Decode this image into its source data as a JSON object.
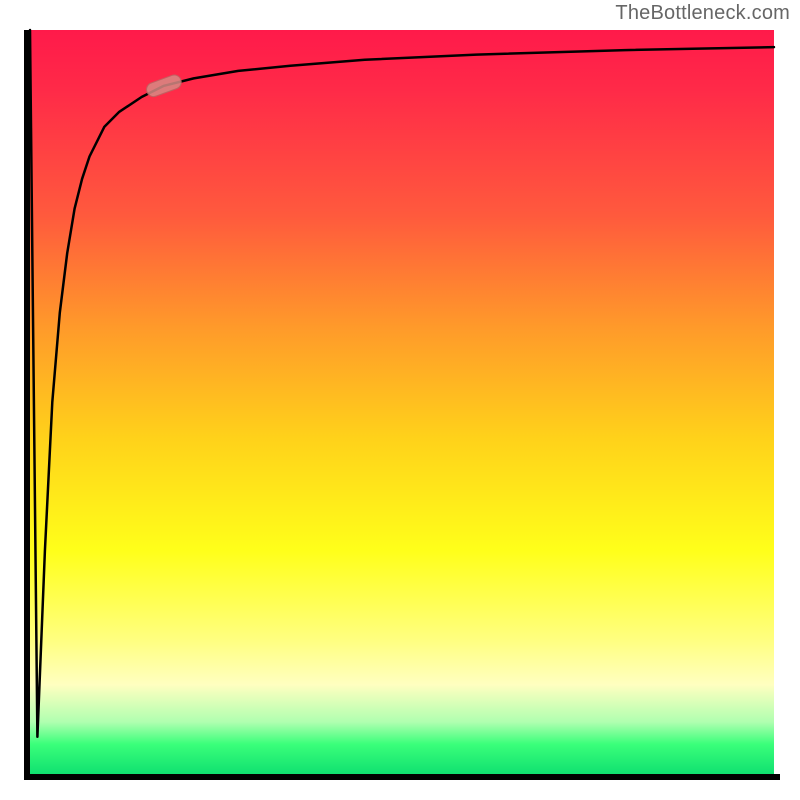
{
  "attribution": "TheBottleneck.com",
  "chart_data": {
    "type": "line",
    "title": "",
    "xlabel": "",
    "ylabel": "",
    "xlim": [
      0,
      100
    ],
    "ylim": [
      0,
      100
    ],
    "series": [
      {
        "name": "curve",
        "x": [
          0,
          1,
          2,
          3,
          4,
          5,
          6,
          7,
          8,
          10,
          12,
          15,
          18,
          22,
          28,
          35,
          45,
          60,
          80,
          100
        ],
        "y": [
          100,
          5,
          30,
          50,
          62,
          70,
          76,
          80,
          83,
          87,
          89,
          91,
          92.5,
          93.5,
          94.5,
          95.2,
          96,
          96.7,
          97.3,
          97.7
        ]
      }
    ],
    "marker": {
      "x": 18,
      "y": 92.5,
      "angle_deg": 20
    },
    "background_gradient": {
      "top": "#ff1a4a",
      "mid": "#ffff1a",
      "bottom": "#10e070"
    }
  }
}
